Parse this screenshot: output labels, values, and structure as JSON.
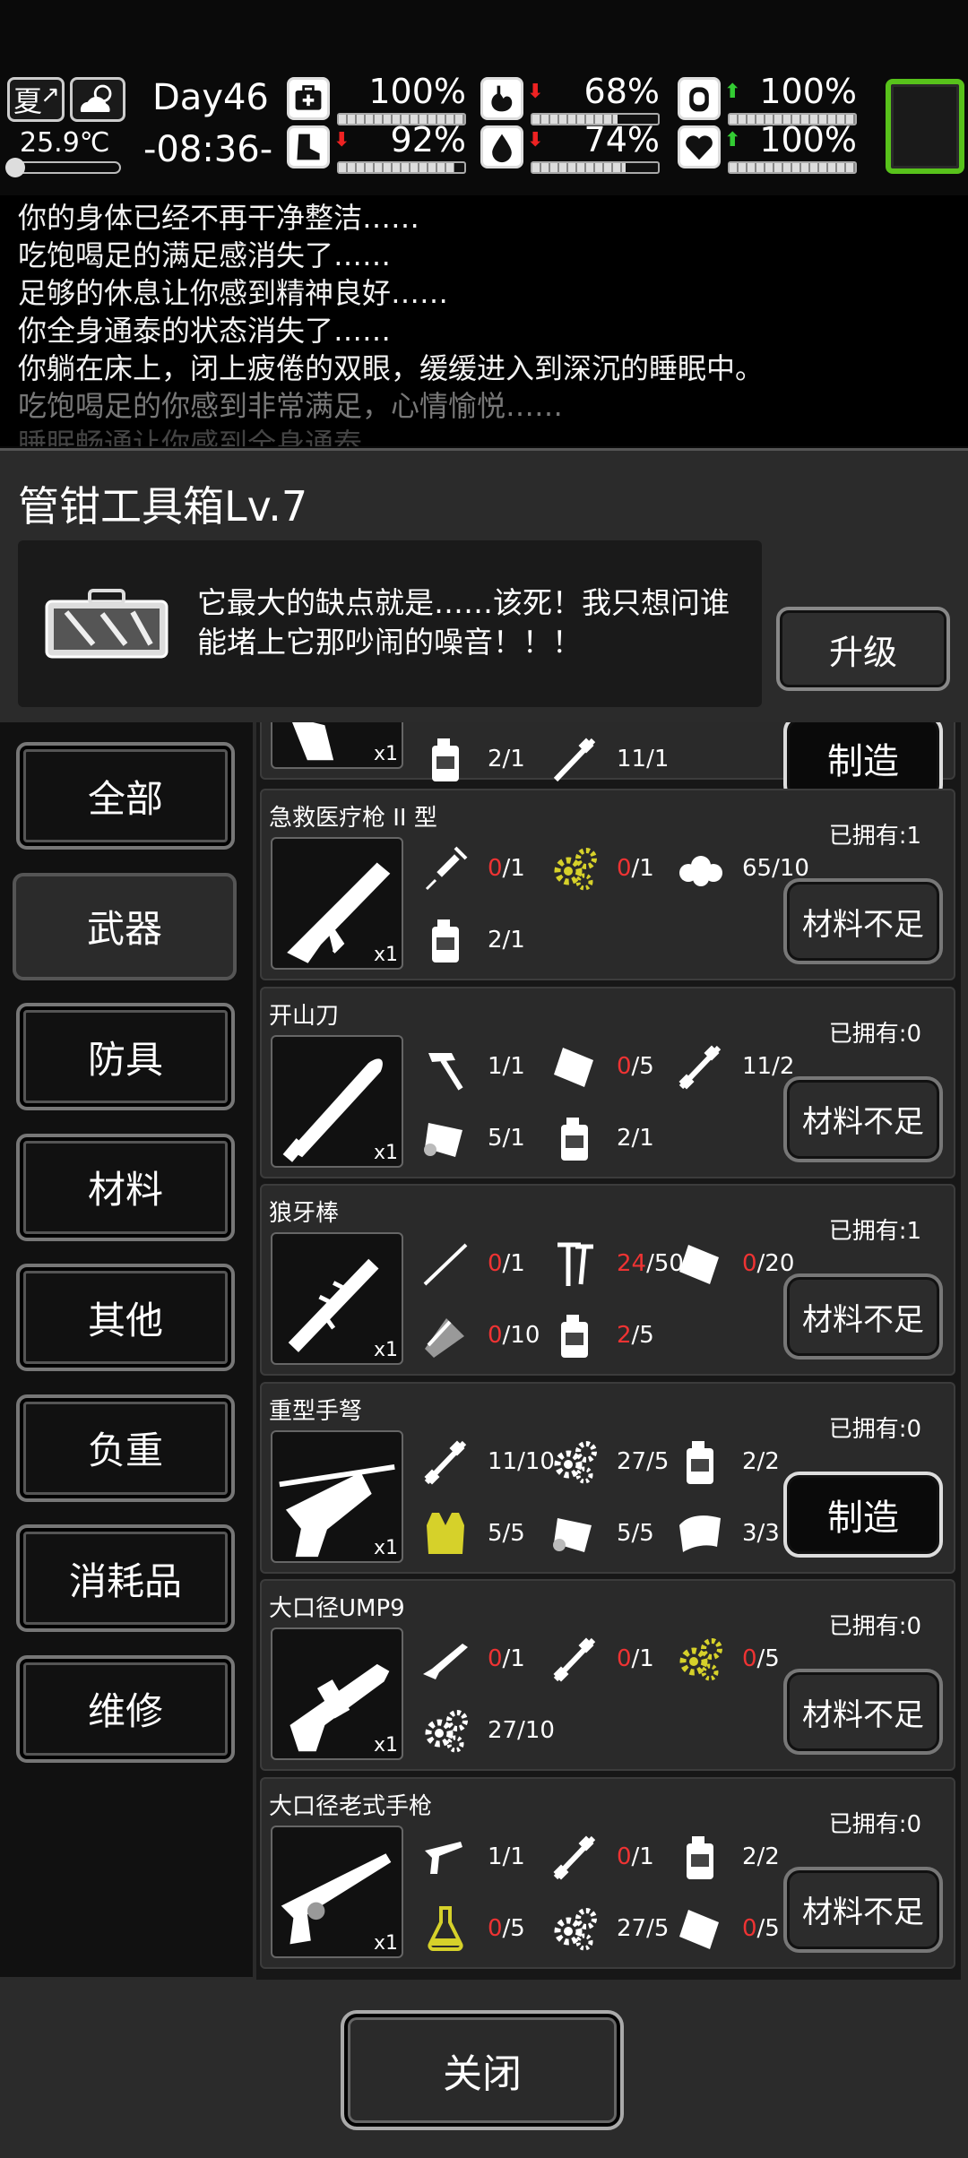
{
  "status": {
    "season": "夏",
    "temperature": "25.9℃",
    "day": "Day46",
    "time": "-08:36-",
    "stats": [
      {
        "name": "health",
        "icon": "medkit-icon",
        "trend": "",
        "trend_color": "",
        "value": "100%",
        "level": 1.0
      },
      {
        "name": "hunger",
        "icon": "stomach-icon",
        "trend": "⬇",
        "trend_color": "#e22",
        "value": "68%",
        "level": 0.68
      },
      {
        "name": "hygiene",
        "icon": "soap-icon",
        "trend": "⬆",
        "trend_color": "#3c3",
        "value": "100%",
        "level": 1.0
      },
      {
        "name": "stamina",
        "icon": "boot-icon",
        "trend": "⬇",
        "trend_color": "#e22",
        "value": "92%",
        "level": 0.92
      },
      {
        "name": "thirst",
        "icon": "water-drop-icon",
        "trend": "⬇",
        "trend_color": "#e22",
        "value": "74%",
        "level": 0.74
      },
      {
        "name": "mood",
        "icon": "heart-icon",
        "trend": "⬆",
        "trend_color": "#3c3",
        "value": "100%",
        "level": 1.0
      }
    ]
  },
  "log": [
    "你的身体已经不再干净整洁……",
    "吃饱喝足的满足感消失了……",
    "足够的休息让你感到精神良好……",
    "你全身通泰的状态消失了……",
    "你躺在床上，闭上疲倦的双眼，缓缓进入到深沉的睡眠中。",
    "吃饱喝足的你感到非常满足，心情愉悦……",
    "睡眠畅通让你感到全身通泰"
  ],
  "panel": {
    "title": "管钳工具箱Lv.7",
    "description": "它最大的缺点就是……该死！我只想问谁能堵上它那吵闹的噪音！！！",
    "upgrade_label": "升级",
    "close_label": "关闭"
  },
  "tabs": [
    "全部",
    "武器",
    "防具",
    "材料",
    "其他",
    "负重",
    "消耗品",
    "维修"
  ],
  "active_tab": "武器",
  "partial_recipe": {
    "materials": [
      "2/1",
      "11/1"
    ],
    "button": "制造",
    "qty": "x1"
  },
  "recipes": [
    {
      "name": "急救医疗枪 II 型",
      "owned": "已拥有:1",
      "button": "材料不足",
      "qty": "x1",
      "materials": [
        {
          "icon": "syringe-icon",
          "have": "0",
          "need": "/1",
          "short": true
        },
        {
          "icon": "gears-icon",
          "have": "0",
          "need": "/1",
          "short": true
        },
        {
          "icon": "cotton-icon",
          "have": "65",
          "need": "/10",
          "short": false
        },
        {
          "icon": "fuel-can-icon",
          "have": "2",
          "need": "/1",
          "short": false
        }
      ]
    },
    {
      "name": "开山刀",
      "owned": "已拥有:0",
      "button": "材料不足",
      "qty": "x1",
      "materials": [
        {
          "icon": "hammer-icon",
          "have": "1",
          "need": "/1",
          "short": false
        },
        {
          "icon": "metal-plate-icon",
          "have": "0",
          "need": "/5",
          "short": true
        },
        {
          "icon": "pipe-icon",
          "have": "11",
          "need": "/2",
          "short": false
        },
        {
          "icon": "cloth-roll-icon",
          "have": "5",
          "need": "/1",
          "short": false
        },
        {
          "icon": "fuel-can-icon",
          "have": "2",
          "need": "/1",
          "short": false
        }
      ]
    },
    {
      "name": "狼牙棒",
      "owned": "已拥有:1",
      "button": "材料不足",
      "qty": "x1",
      "materials": [
        {
          "icon": "stick-icon",
          "have": "0",
          "need": "/1",
          "short": true
        },
        {
          "icon": "nails-icon",
          "have": "24",
          "need": "/50",
          "short": true
        },
        {
          "icon": "metal-plate-icon",
          "have": "0",
          "need": "/20",
          "short": true
        },
        {
          "icon": "wire-icon",
          "have": "0",
          "need": "/10",
          "short": true
        },
        {
          "icon": "fuel-can-icon",
          "have": "2",
          "need": "/5",
          "short": true
        }
      ]
    },
    {
      "name": "重型手弩",
      "owned": "已拥有:0",
      "button": "制造",
      "can_craft": true,
      "qty": "x1",
      "materials": [
        {
          "icon": "pipe-icon",
          "have": "11",
          "need": "/10",
          "short": false
        },
        {
          "icon": "gears-icon",
          "have": "27",
          "need": "/5",
          "short": false
        },
        {
          "icon": "fuel-can-icon",
          "have": "2",
          "need": "/2",
          "short": false
        },
        {
          "icon": "vest-icon",
          "have": "5",
          "need": "/5",
          "short": false
        },
        {
          "icon": "cloth-roll-icon",
          "have": "5",
          "need": "/5",
          "short": false
        },
        {
          "icon": "leather-icon",
          "have": "3",
          "need": "/3",
          "short": false
        }
      ]
    },
    {
      "name": "大口径UMP9",
      "owned": "已拥有:0",
      "button": "材料不足",
      "qty": "x1",
      "materials": [
        {
          "icon": "rifle-icon",
          "have": "0",
          "need": "/1",
          "short": true
        },
        {
          "icon": "pipe-icon",
          "have": "0",
          "need": "/1",
          "short": true
        },
        {
          "icon": "gears-icon",
          "have": "0",
          "need": "/5",
          "short": true
        },
        {
          "icon": "gears-icon",
          "have": "27",
          "need": "/10",
          "short": false
        }
      ]
    },
    {
      "name": "大口径老式手枪",
      "owned": "已拥有:0",
      "button": "材料不足",
      "qty": "x1",
      "materials": [
        {
          "icon": "revolver-icon",
          "have": "1",
          "need": "/1",
          "short": false
        },
        {
          "icon": "pipe-icon",
          "have": "0",
          "need": "/1",
          "short": true
        },
        {
          "icon": "fuel-can-icon",
          "have": "2",
          "need": "/2",
          "short": false
        },
        {
          "icon": "flask-icon",
          "have": "0",
          "need": "/5",
          "short": true
        },
        {
          "icon": "gears-icon",
          "have": "27",
          "need": "/5",
          "short": false
        },
        {
          "icon": "metal-plate-icon",
          "have": "0",
          "need": "/5",
          "short": true
        }
      ]
    }
  ]
}
